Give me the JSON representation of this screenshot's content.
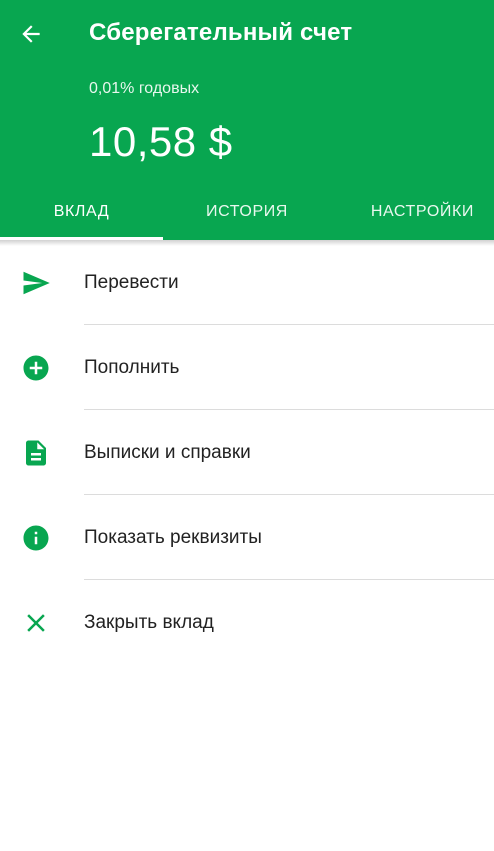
{
  "colors": {
    "accent": "#08a650",
    "text": "#222222",
    "divider": "#dcdcdc"
  },
  "header": {
    "back_icon": "arrow-left-icon",
    "title": "Сберегательный счет",
    "rate": "0,01% годовых",
    "balance": "10,58 $"
  },
  "tabs": [
    {
      "label": "ВКЛАД",
      "active": true
    },
    {
      "label": "ИСТОРИЯ",
      "active": false
    },
    {
      "label": "НАСТРОЙКИ",
      "active": false
    }
  ],
  "actions": [
    {
      "label": "Перевести",
      "icon": "send-icon"
    },
    {
      "label": "Пополнить",
      "icon": "add-circle-icon"
    },
    {
      "label": "Выписки и справки",
      "icon": "document-icon"
    },
    {
      "label": "Показать реквизиты",
      "icon": "info-icon"
    },
    {
      "label": "Закрыть вклад",
      "icon": "close-icon"
    }
  ]
}
